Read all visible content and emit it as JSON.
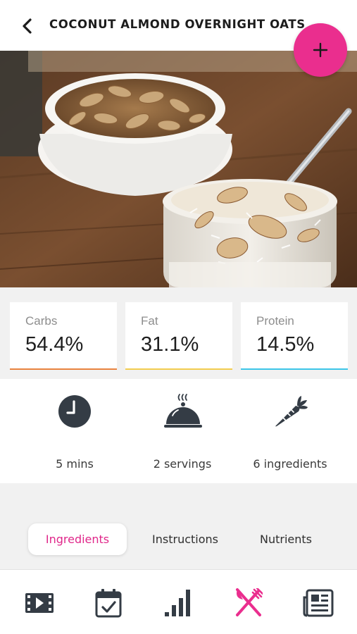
{
  "header": {
    "title": "COCONUT ALMOND OVERNIGHT OATS",
    "back_icon": "chevron-left-icon",
    "add_icon": "plus-icon"
  },
  "colors": {
    "accent": "#ea2e8e",
    "carbs": "#e9833f",
    "fat": "#f2cc4f",
    "protein": "#3cc6e8",
    "icon_dark": "#343c45"
  },
  "macros": [
    {
      "label": "Carbs",
      "value": "54.4%"
    },
    {
      "label": "Fat",
      "value": "31.1%"
    },
    {
      "label": "Protein",
      "value": "14.5%"
    }
  ],
  "stats": [
    {
      "label": "5 mins",
      "icon": "clock-icon"
    },
    {
      "label": "2 servings",
      "icon": "serving-cloche-icon"
    },
    {
      "label": "6 ingredients",
      "icon": "carrot-icon"
    }
  ],
  "tabs": [
    {
      "label": "Ingredients",
      "active": true
    },
    {
      "label": "Instructions",
      "active": false
    },
    {
      "label": "Nutrients",
      "active": false
    }
  ],
  "bottom_nav": [
    {
      "icon": "video-icon"
    },
    {
      "icon": "calendar-check-icon"
    },
    {
      "icon": "bar-chart-icon"
    },
    {
      "icon": "fork-knife-icon",
      "active": true
    },
    {
      "icon": "newspaper-icon"
    }
  ]
}
